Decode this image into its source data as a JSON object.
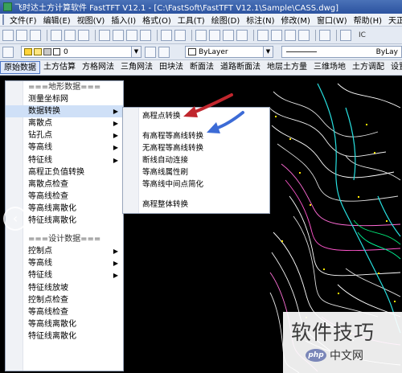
{
  "window": {
    "title": "飞时达土方计算软件 FastTFT V12.1 - [C:\\FastSoft\\FastTFT V12.1\\Sample\\CASS.dwg]"
  },
  "menubar": {
    "items": [
      "文件(F)",
      "编辑(E)",
      "视图(V)",
      "插入(I)",
      "格式(O)",
      "工具(T)",
      "绘图(D)",
      "标注(N)",
      "修改(M)",
      "窗口(W)",
      "帮助(H)",
      "天正"
    ]
  },
  "toolbar": {
    "text_style_label": "IC",
    "layer_value": "0",
    "color_value": "ByLayer",
    "linetype_value": "ByLay"
  },
  "funcbar": {
    "tabs": [
      "原始数据",
      "土方估算",
      "方格网法",
      "三角网法",
      "田块法",
      "断面法",
      "道路断面法",
      "地层土方量",
      "三维场地",
      "土方调配",
      "设置和出"
    ],
    "active_index": 0
  },
  "side_menu": {
    "items": [
      {
        "label": "===地形数据===",
        "type": "header"
      },
      {
        "label": "测量坐标网",
        "type": "item"
      },
      {
        "label": "数据转换",
        "type": "submenu",
        "highlighted": true
      },
      {
        "label": "离散点",
        "type": "submenu"
      },
      {
        "label": "钻孔点",
        "type": "submenu"
      },
      {
        "label": "等高线",
        "type": "submenu"
      },
      {
        "label": "特征线",
        "type": "submenu"
      },
      {
        "label": "高程正负值转换",
        "type": "item"
      },
      {
        "label": "离散点检查",
        "type": "item"
      },
      {
        "label": "等高线检查",
        "type": "item"
      },
      {
        "label": "等高线离散化",
        "type": "item"
      },
      {
        "label": "特征线离散化",
        "type": "item"
      },
      {
        "label": "===设计数据===",
        "type": "header"
      },
      {
        "label": "控制点",
        "type": "submenu"
      },
      {
        "label": "等高线",
        "type": "submenu"
      },
      {
        "label": "特征线",
        "type": "submenu"
      },
      {
        "label": "特征线放坡",
        "type": "item"
      },
      {
        "label": "控制点检查",
        "type": "item"
      },
      {
        "label": "等高线检查",
        "type": "item"
      },
      {
        "label": "等高线离散化",
        "type": "item"
      },
      {
        "label": "特征线离散化",
        "type": "item"
      }
    ]
  },
  "sub_menu": {
    "group1": [
      "高程点转换"
    ],
    "group2": [
      "有高程等高线转换",
      "无高程等高线转换",
      "断线自动连接",
      "等高线属性刷",
      "等高线中间点简化"
    ],
    "group3": [
      "高程整体转换"
    ]
  },
  "annotations": {
    "red_arrow_color": "#c0262d",
    "blue_arrow_color": "#3c6bd6"
  },
  "nav": {
    "prev_glyph": "‹"
  },
  "watermark": {
    "text": "软件技巧",
    "logo_text": "php",
    "site": "中文网"
  }
}
